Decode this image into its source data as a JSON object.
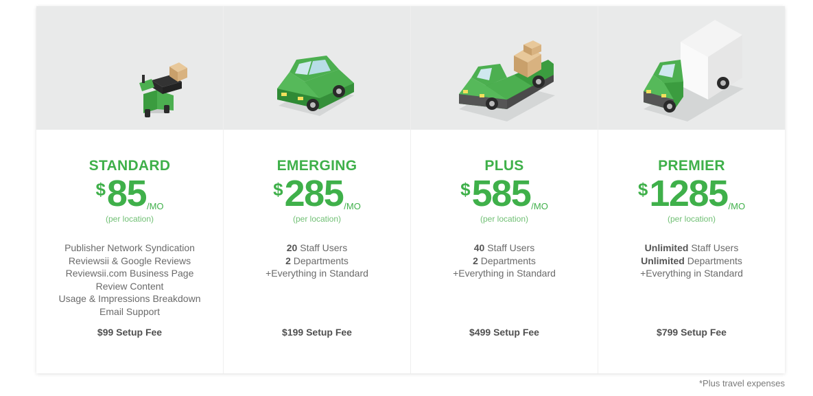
{
  "currency_symbol": "$",
  "plans": [
    {
      "name": "STANDARD",
      "amount": "85",
      "period": "/MO",
      "per_location": "(per location)",
      "vehicle_icon": "scooter-icon",
      "features": [
        {
          "bold": "",
          "text": "Publisher Network Syndication"
        },
        {
          "bold": "",
          "text": "Reviewsii & Google Reviews"
        },
        {
          "bold": "",
          "text": "Reviewsii.com Business Page"
        },
        {
          "bold": "",
          "text": "Review Content"
        },
        {
          "bold": "",
          "text": "Usage & Impressions Breakdown"
        },
        {
          "bold": "",
          "text": "Email Support"
        }
      ],
      "setup_fee": "$99 Setup Fee"
    },
    {
      "name": "EMERGING",
      "amount": "285",
      "period": "/MO",
      "per_location": "(per location)",
      "vehicle_icon": "car-icon",
      "features": [
        {
          "bold": "20",
          "text": " Staff Users"
        },
        {
          "bold": "2",
          "text": " Departments"
        },
        {
          "bold": "",
          "text": "+Everything in Standard"
        }
      ],
      "setup_fee": "$199 Setup Fee"
    },
    {
      "name": "PLUS",
      "amount": "585",
      "period": "/MO",
      "per_location": "(per location)",
      "vehicle_icon": "pickup-truck-icon",
      "features": [
        {
          "bold": "40",
          "text": " Staff Users"
        },
        {
          "bold": "2",
          "text": " Departments"
        },
        {
          "bold": "",
          "text": "+Everything in Standard"
        }
      ],
      "setup_fee": "$499 Setup Fee"
    },
    {
      "name": "PREMIER",
      "amount": "1285",
      "period": "/MO",
      "per_location": "(per location)",
      "vehicle_icon": "box-truck-icon",
      "features": [
        {
          "bold": "Unlimited",
          "text": " Staff Users"
        },
        {
          "bold": "Unlimited",
          "text": " Departments"
        },
        {
          "bold": "",
          "text": "+Everything in Standard"
        }
      ],
      "setup_fee": "$799 Setup Fee"
    }
  ],
  "footnote": "*Plus travel expenses",
  "colors": {
    "accent_green": "#3fb04a",
    "vehicle_green": "#4caf50",
    "header_bg": "#e9eaea"
  }
}
